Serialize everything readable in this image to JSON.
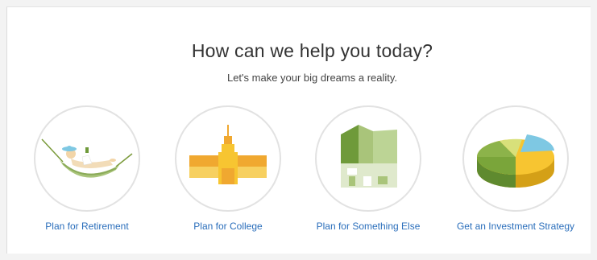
{
  "header": {
    "title": "How can we help you today?",
    "subtitle": "Let's make your big dreams a reality."
  },
  "options": [
    {
      "label": "Plan for Retirement",
      "icon": "hammock-icon"
    },
    {
      "label": "Plan for College",
      "icon": "college-building-icon"
    },
    {
      "label": "Plan for Something Else",
      "icon": "house-icon"
    },
    {
      "label": "Get an Investment Strategy",
      "icon": "pie-chart-icon"
    }
  ],
  "colors": {
    "link": "#2a6ebb",
    "circle_border": "#e2e2e2",
    "green_dark": "#6f9a3a",
    "green_light": "#a9c47a",
    "yellow": "#f7c531",
    "orange": "#f0a830",
    "blue": "#7ec8e3"
  }
}
